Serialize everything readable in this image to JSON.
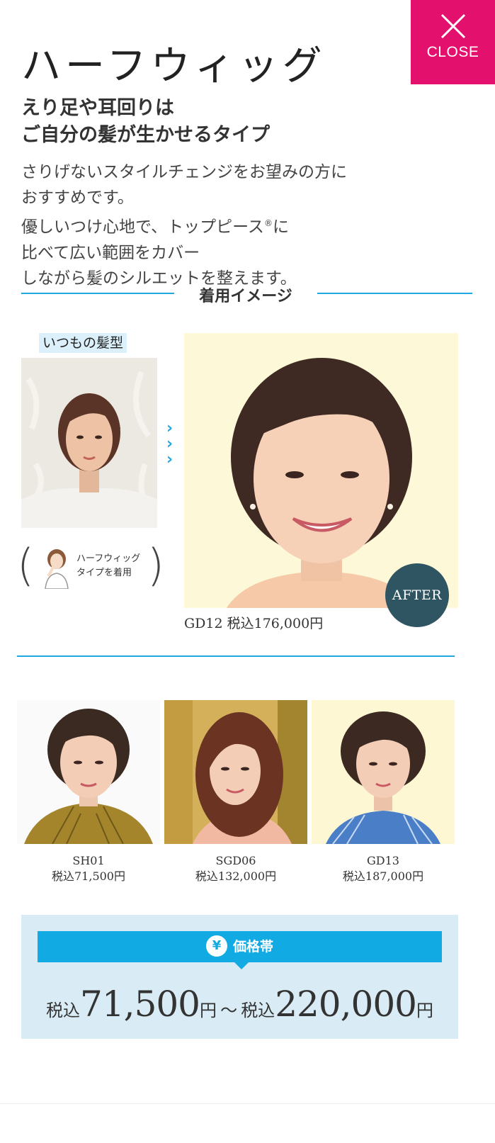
{
  "close": {
    "label": "CLOSE",
    "icon": "close-icon"
  },
  "header": {
    "title": "ハーフウィッグ",
    "subtitle_lines": [
      "えり足や耳回りは",
      "ご自分の髪が生かせるタイプ"
    ],
    "description_lines": [
      "さりげないスタイルチェンジをお望みの方に",
      "おすすめです。",
      "優しいつけ心地で、トップピース",
      "比べて広い範囲をカバー",
      "しながら髪のシルエットを整えます。"
    ],
    "description_registered": "®",
    "description_after_mark": "に"
  },
  "section": {
    "heading": "着用イメージ"
  },
  "comparison": {
    "before_tag": "いつもの髪型",
    "wear_badge_lines": [
      "ハーフウィッグ",
      "タイプを着用"
    ],
    "after_badge": "AFTER",
    "main_caption": "GD12 税込176,000円",
    "arrow_icon": "chevron-right-icon"
  },
  "products": [
    {
      "code": "SH01",
      "price": "税込71,500円"
    },
    {
      "code": "SGD06",
      "price": "税込132,000円"
    },
    {
      "code": "GD13",
      "price": "税込187,000円"
    }
  ],
  "price_range": {
    "heading": "価格帯",
    "yen_symbol": "¥",
    "tax_label": "税込",
    "min": "71,500",
    "max": "220,000",
    "unit": "円",
    "separator": "～"
  },
  "colors": {
    "accent_pink": "#e4106e",
    "accent_blue": "#1fa8e0",
    "after_badge": "#2f5563",
    "price_panel": "#d9ecf5"
  }
}
